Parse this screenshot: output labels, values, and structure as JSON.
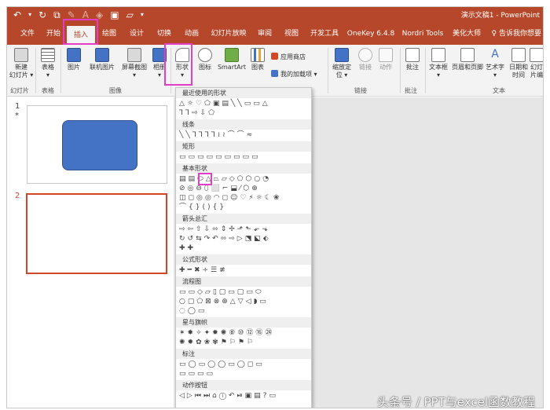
{
  "title": "演示文稿1 - PowerPoint",
  "qat": {
    "undo": "↶",
    "undo_dropdown": "▾",
    "redo": "↻",
    "start": "⧉",
    "format_painter": "✎",
    "font_color": "A",
    "shape": "◈",
    "save": "▣",
    "open": "▱",
    "more": "▾"
  },
  "tabs": [
    "文件",
    "开始",
    "插入",
    "绘图",
    "设计",
    "切换",
    "动画",
    "幻灯片放映",
    "审阅",
    "视图",
    "开发工具",
    "OneKey 6.4.8",
    "Nordri Tools",
    "美化大师"
  ],
  "active_tab": "插入",
  "tell_me": "告诉我你想要",
  "ribbon": {
    "buttons": {
      "new_slide": "新建\n幻灯片 ▾",
      "table": "表格\n▾",
      "picture": "图片",
      "online_picture": "联机图片",
      "screenshot": "屏幕截图\n▾",
      "album": "相册\n▾",
      "shapes": "形状\n▾",
      "icons": "图标",
      "smartart": "SmartArt",
      "chart": "图表",
      "zoom": "缩放定\n位 ▾",
      "link": "链接",
      "action": "动作",
      "comment": "批注",
      "textbox": "文本框\n▾",
      "header_footer": "页眉和页脚",
      "wordart": "艺术字\n▾",
      "datetime": "日期和时间",
      "slide_number": "幻灯\n片编"
    },
    "small": {
      "app_store": "应用商店",
      "my_addins": "我的加载项"
    },
    "groups": [
      "幻灯片",
      "表格",
      "图像",
      "链接",
      "批注",
      "文本"
    ]
  },
  "slides": [
    {
      "number": "1",
      "marker": "*"
    },
    {
      "number": "2"
    }
  ],
  "shapes_menu": {
    "sections": [
      "最近使用的形状",
      "线条",
      "矩形",
      "基本形状",
      "箭头总汇",
      "公式形状",
      "流程图",
      "星与旗帜",
      "标注",
      "动作按钮"
    ],
    "rows": [
      "△☼♡⬠▣▤╲╲▭▭△",
      "⅂⅂⇨⇩⬠",
      "╲╲⅂⅂⅂⅂≀≀⌒⌒≈",
      "▭▭▭▭▭▭▭▭▭",
      "▤▤⬭△⏢▱◇⬠⬡○◔",
      "⊘◎⊖⬯⬜⌐⬓⁄⬡⊕",
      "◫◻◎◎◠◻☺♡⚡☼☾❀",
      "⌒{}(){}",
      "⇨⇦⇧⇩⬄⇕✢⬏⬑⬐⬎",
      "↻↺⇆↷↶⬄⇨▷⬔⬕⬖",
      "✚✚",
      "✚━✖÷☰≢",
      "▭▭◇▱▯▢▭▢▭⬭",
      "○▢⬠⊠⊗⊕△▽◁◗▭",
      "◌◯▭",
      "✶✸✧✦✹✺⑧⑩⑫⑯㉔",
      "✺✹✿❀✾⚑⚐⚑⚐",
      "▭◯▭◯◯▭◯◻▭",
      "▭▭▭▭",
      "◁▷⏮⏭⌂ⓘ↶⏯▣▤?▭"
    ]
  },
  "watermark": "头条号 / PPT与excel函数教程",
  "colors": {
    "brand": "#b7472a",
    "highlight": "#e43dc6",
    "shape_fill": "#4472c4",
    "selected_slide": "#d24726"
  }
}
